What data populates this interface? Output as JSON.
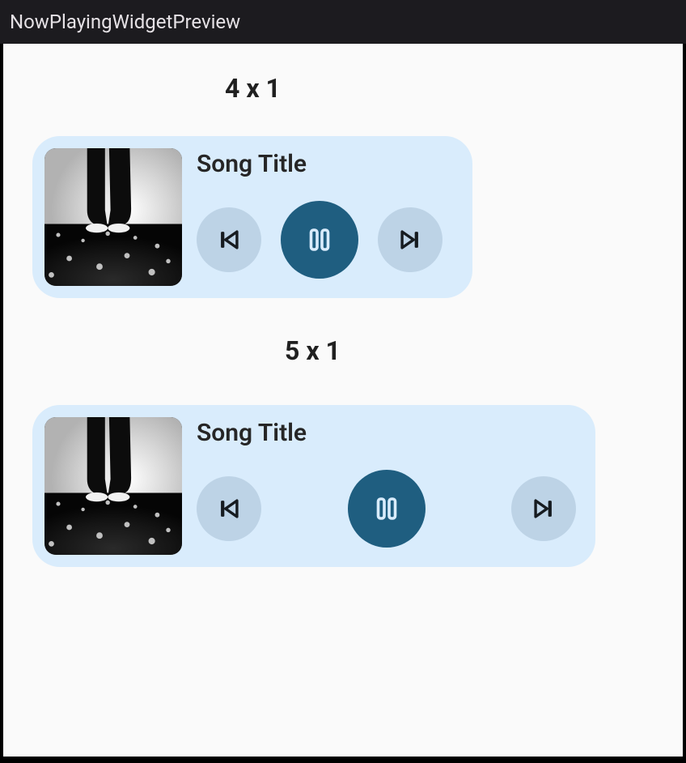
{
  "header": {
    "title": "NowPlayingWidgetPreview"
  },
  "icons": {
    "prev": "skip-previous-icon",
    "pause": "pause-icon",
    "next": "skip-next-icon",
    "album": "album-art-icon"
  },
  "colors": {
    "widget_bg": "#d9ecfc",
    "side_btn_bg": "#bdd3e6",
    "center_btn_bg": "#1f5e80",
    "icon_dark": "#161b20",
    "center_icon": "#d9ecfc"
  },
  "widgets": [
    {
      "label": "4 x 1",
      "song_title": "Song Title"
    },
    {
      "label": "5 x 1",
      "song_title": "Song Title"
    }
  ]
}
